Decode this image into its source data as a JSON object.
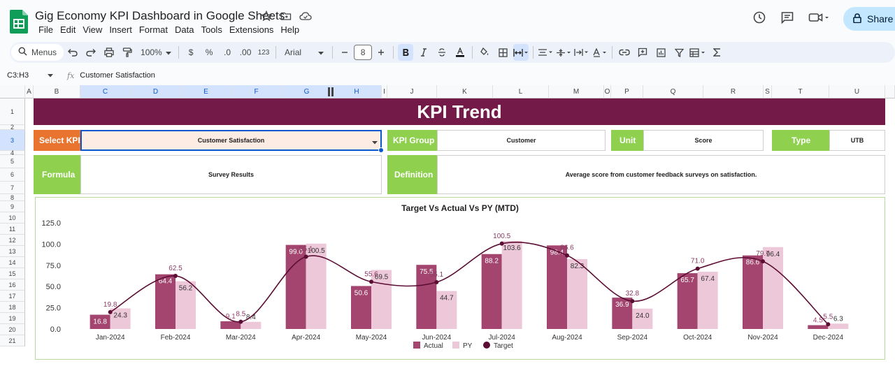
{
  "app": {
    "doc_title": "Gig Economy KPI Dashboard in Google Sheets",
    "menu": [
      "File",
      "Edit",
      "View",
      "Insert",
      "Format",
      "Data",
      "Tools",
      "Extensions",
      "Help"
    ],
    "share_label": "Share"
  },
  "toolbar": {
    "menus_label": "Menus",
    "zoom": "100%",
    "currency": "$",
    "percent": "%",
    "dec_decrease": ".0",
    "dec_increase": ".00",
    "number_format": "123",
    "font": "Arial",
    "font_size": "8"
  },
  "formula_bar": {
    "name_box": "C3:H3",
    "fx": "fx",
    "content": "Customer Satisfaction"
  },
  "sheet": {
    "columns": [
      "A",
      "B",
      "C",
      "D",
      "E",
      "F",
      "G",
      "H",
      "I",
      "J",
      "K",
      "L",
      "M",
      "O",
      "P",
      "Q",
      "R",
      "S",
      "T",
      "U"
    ],
    "rows": [
      "1",
      "2",
      "3",
      "4",
      "5",
      "6",
      "7",
      "8",
      "9",
      "10",
      "11",
      "12",
      "13",
      "14",
      "15",
      "16",
      "17",
      "18",
      "19",
      "20",
      "21"
    ],
    "banner": "KPI Trend",
    "select_kpi_label": "Select KPI",
    "select_kpi_value": "Customer Satisfaction",
    "kpi_group_label": "KPI Group",
    "kpi_group_value": "Customer",
    "unit_label": "Unit",
    "unit_value": "Score",
    "type_label": "Type",
    "type_value": "UTB",
    "formula_label": "Formula",
    "formula_value": "Survey Results",
    "definition_label": "Definition",
    "definition_value": "Average score from customer feedback surveys on satisfaction."
  },
  "colors": {
    "banner": "#731a48",
    "label_green": "#8fd14f",
    "label_orange": "#e8742f",
    "actual": "#a3456f",
    "py": "#edc8d8",
    "target": "#5b0d33"
  },
  "chart_data": {
    "type": "bar",
    "title": "Target Vs Actual Vs PY (MTD)",
    "categories": [
      "Jan-2024",
      "Feb-2024",
      "Mar-2024",
      "Apr-2024",
      "May-2024",
      "Jun-2024",
      "Jul-2024",
      "Aug-2024",
      "Sep-2024",
      "Oct-2024",
      "Nov-2024",
      "Dec-2024"
    ],
    "series": [
      {
        "name": "Actual",
        "kind": "bar",
        "values": [
          16.8,
          64.4,
          9.1,
          99.0,
          50.6,
          75.5,
          88.2,
          98.4,
          36.9,
          65.7,
          86.6,
          4.5
        ]
      },
      {
        "name": "PY",
        "kind": "bar",
        "values": [
          24.3,
          56.2,
          8.4,
          100.5,
          69.5,
          44.7,
          103.6,
          82.3,
          24.0,
          67.4,
          96.4,
          6.3
        ]
      },
      {
        "name": "Target",
        "kind": "line",
        "values": [
          19.8,
          62.5,
          8.5,
          85.1,
          55.6,
          55.1,
          100.5,
          86.6,
          32.8,
          71.0,
          79.7,
          5.5
        ]
      }
    ],
    "y_ticks": [
      "0.0",
      "25.0",
      "50.0",
      "75.0",
      "100.0",
      "125.0"
    ],
    "ylim": [
      0,
      125
    ],
    "legend": "bottom",
    "grid": false
  }
}
